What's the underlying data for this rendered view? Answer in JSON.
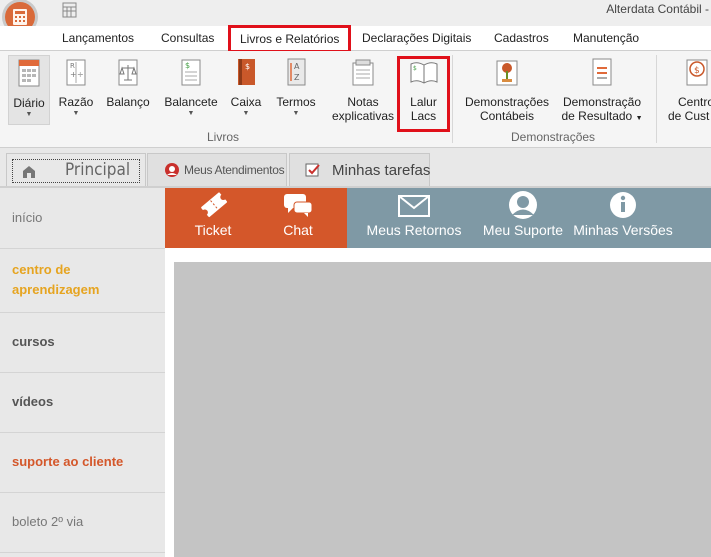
{
  "window": {
    "title": "Alterdata Contábil -"
  },
  "ribbon_tabs": [
    {
      "label": "Lançamentos"
    },
    {
      "label": "Consultas"
    },
    {
      "label": "Livros e Relatórios"
    },
    {
      "label": "Declarações Digitais"
    },
    {
      "label": "Cadastros"
    },
    {
      "label": "Manutenção"
    }
  ],
  "ribbon": {
    "livros": {
      "group_label": "Livros",
      "buttons": [
        {
          "label": "Diário",
          "icon": "diario-book-icon"
        },
        {
          "label": "Razão",
          "icon": "razao-ledger-icon"
        },
        {
          "label": "Balanço",
          "icon": "scale-icon"
        },
        {
          "label": "Balancete",
          "icon": "balancete-document-icon"
        },
        {
          "label": "Caixa",
          "icon": "cash-book-icon"
        },
        {
          "label": "Termos",
          "icon": "sort-az-icon"
        },
        {
          "label_line1": "Notas",
          "label_line2": "explicativas",
          "icon": "notes-icon"
        },
        {
          "label_line1": "Lalur",
          "label_line2": "Lacs",
          "icon": "open-book-icon"
        }
      ]
    },
    "demonstracoes": {
      "group_label": "Demonstrações",
      "buttons": [
        {
          "label_line1": "Demonstrações",
          "label_line2": "Contábeis",
          "icon": "money-tree-icon"
        },
        {
          "label_line1": "Demonstração",
          "label_line2": "de Resultado",
          "icon": "result-document-icon"
        }
      ]
    },
    "partial": {
      "label_line1": "Centro",
      "label_line2": "de Cust",
      "icon": "dollar-coin-icon"
    }
  },
  "doc_tabs": [
    {
      "label": "Principal",
      "icon": "home-icon"
    },
    {
      "label": "Meus Atendimentos",
      "icon": "support-agent-icon"
    },
    {
      "label": "Minhas tarefas",
      "icon": "checkbox-icon"
    }
  ],
  "left_nav": [
    {
      "label": "início",
      "color": "#777777",
      "bold": false
    },
    {
      "label": "centro de aprendizagem",
      "color": "#e6a420",
      "bold": true
    },
    {
      "label": "cursos",
      "color": "#555555",
      "bold": true
    },
    {
      "label": "vídeos",
      "color": "#555555",
      "bold": true
    },
    {
      "label": "suporte ao cliente",
      "color": "#d4572a",
      "bold": true
    },
    {
      "label": "boleto 2º via",
      "color": "#777777",
      "bold": false
    }
  ],
  "actions": [
    {
      "label": "Ticket",
      "icon": "ticket-icon"
    },
    {
      "label": "Chat",
      "icon": "chat-bubbles-icon"
    },
    {
      "label": "Meus Retornos",
      "icon": "envelope-icon"
    },
    {
      "label": "Meu Suporte",
      "icon": "user-icon"
    },
    {
      "label": "Minhas Versões",
      "icon": "info-icon"
    }
  ],
  "colors": {
    "highlight_red": "#e0101a",
    "orange_bar": "#d4572a",
    "grey_bar": "#7f99a5"
  }
}
